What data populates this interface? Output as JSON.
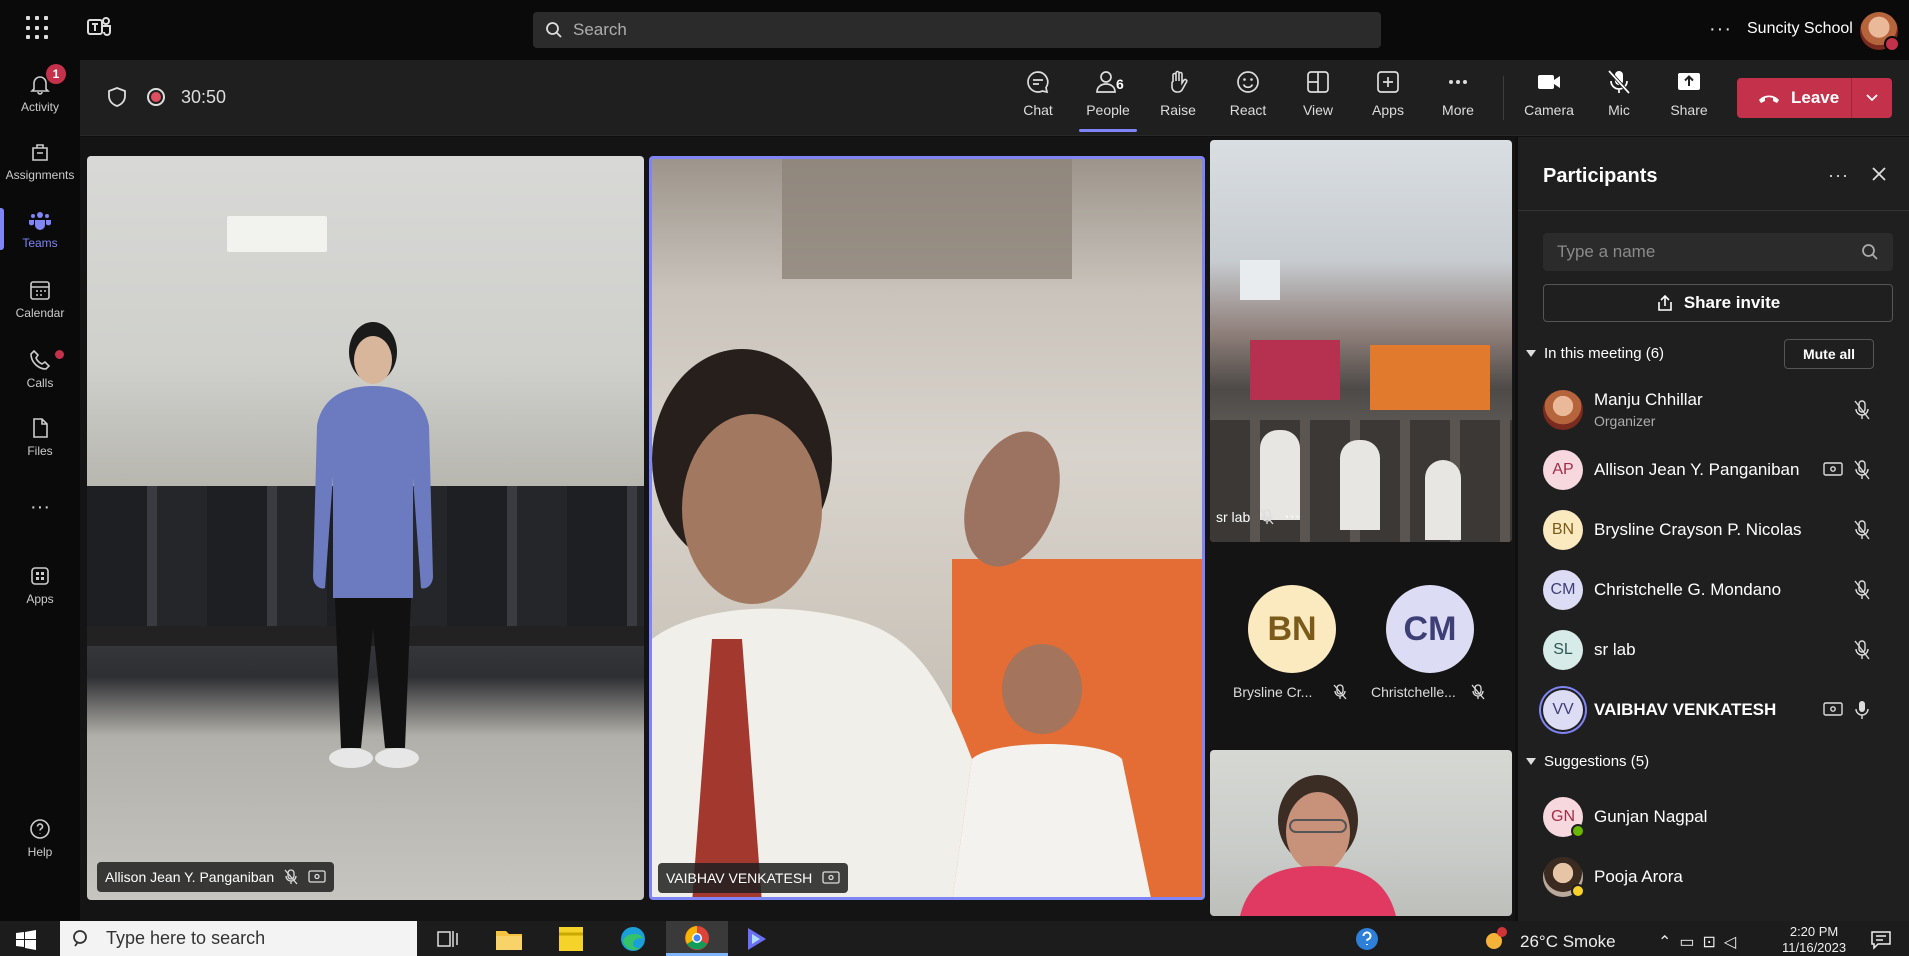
{
  "topbar": {
    "search_placeholder": "Search",
    "org_name": "Suncity School"
  },
  "rail": {
    "items": [
      {
        "label": "Activity",
        "badge": "1"
      },
      {
        "label": "Assignments"
      },
      {
        "label": "Teams"
      },
      {
        "label": "Calendar"
      },
      {
        "label": "Calls"
      },
      {
        "label": "Files"
      },
      {
        "label": "Apps"
      },
      {
        "label": "Help"
      }
    ]
  },
  "meeting": {
    "timer": "30:50",
    "tools": {
      "chat": "Chat",
      "people": "People",
      "people_count": "6",
      "raise": "Raise",
      "react": "React",
      "view": "View",
      "apps": "Apps",
      "more": "More",
      "camera": "Camera",
      "mic": "Mic",
      "share": "Share"
    },
    "leave_label": "Leave"
  },
  "stage": {
    "tile_allison": "Allison Jean Y. Panganiban",
    "tile_vaibhav": "VAIBHAV VENKATESH",
    "tile_srlab": "sr lab",
    "bn_initials": "BN",
    "bn_name": "Brysline Cr...",
    "cm_initials": "CM",
    "cm_name": "Christchelle..."
  },
  "participants": {
    "title": "Participants",
    "search_placeholder": "Type a name",
    "share_invite": "Share invite",
    "in_meeting_header": "In this meeting (6)",
    "mute_all": "Mute all",
    "in_meeting": [
      {
        "initials": "",
        "name": "Manju Chhillar",
        "role": "Organizer"
      },
      {
        "initials": "AP",
        "name": "Allison Jean Y. Panganiban"
      },
      {
        "initials": "BN",
        "name": "Brysline Crayson P. Nicolas"
      },
      {
        "initials": "CM",
        "name": "Christchelle G. Mondano"
      },
      {
        "initials": "SL",
        "name": "sr lab"
      },
      {
        "initials": "VV",
        "name": "VAIBHAV VENKATESH"
      }
    ],
    "suggestions_header": "Suggestions (5)",
    "suggestions": [
      {
        "initials": "GN",
        "name": "Gunjan Nagpal"
      },
      {
        "initials": "",
        "name": "Pooja Arora"
      }
    ]
  },
  "taskbar": {
    "search_placeholder": "Type here to search",
    "weather": "26°C  Smoke",
    "time": "2:20 PM",
    "date": "11/16/2023"
  },
  "colors": {
    "accent": "#7f85f5",
    "leave": "#c4314b"
  }
}
